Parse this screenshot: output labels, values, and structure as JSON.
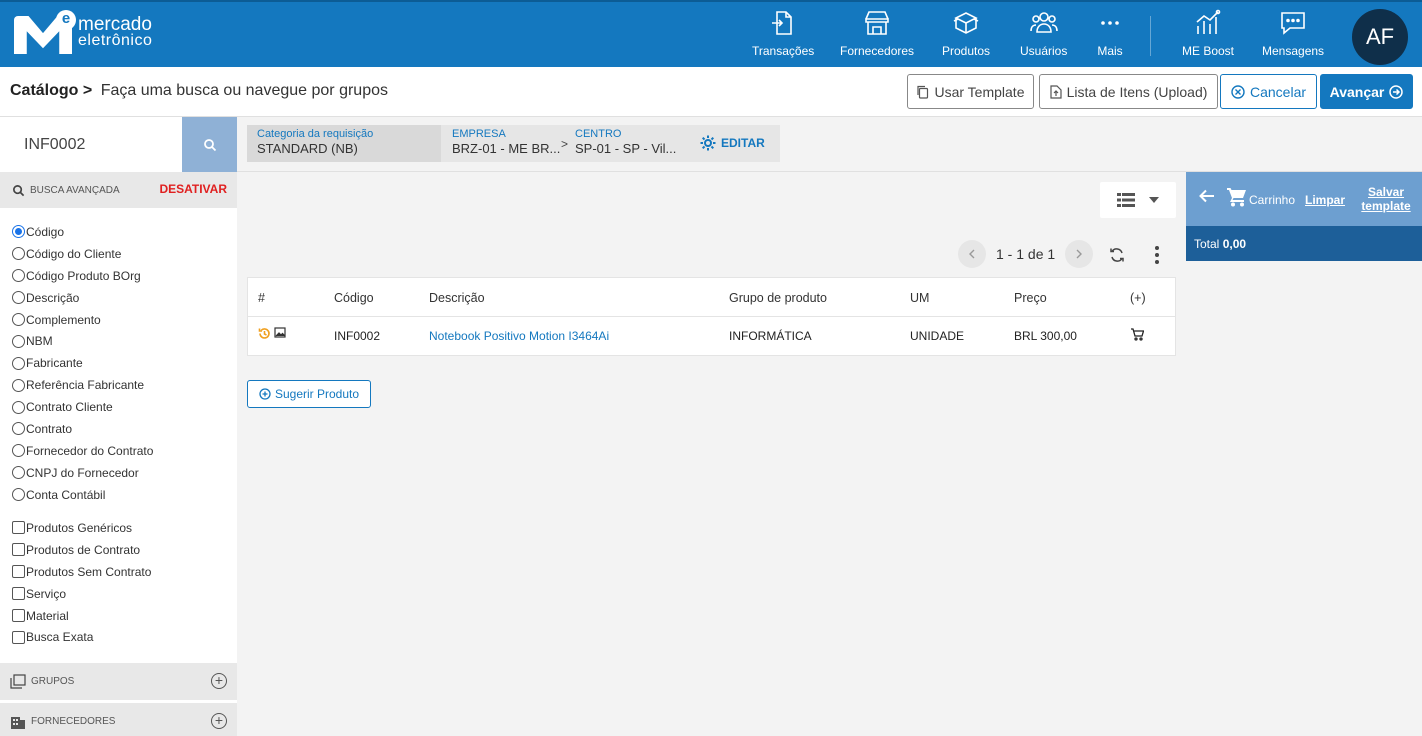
{
  "brand": {
    "line1": "mercado",
    "line2": "eletrônico",
    "mark": "e"
  },
  "nav": [
    {
      "label": "Transações",
      "icon": "transactions-icon"
    },
    {
      "label": "Fornecedores",
      "icon": "store-icon"
    },
    {
      "label": "Produtos",
      "icon": "box-icon"
    },
    {
      "label": "Usuários",
      "icon": "users-icon"
    },
    {
      "label": "Mais",
      "icon": "more-icon"
    },
    {
      "label": "ME Boost",
      "icon": "chart-icon"
    },
    {
      "label": "Mensagens",
      "icon": "messages-icon"
    }
  ],
  "user": {
    "initials": "AF"
  },
  "title": {
    "section": "Catálogo >",
    "text": "Faça uma busca ou navegue por grupos"
  },
  "actions": {
    "template": "Usar Template",
    "upload": "Lista de Itens (Upload)",
    "cancel": "Cancelar",
    "next": "Avançar"
  },
  "search": {
    "value": "INF0002"
  },
  "advanced": {
    "label": "BUSCA AVANÇADA",
    "toggle": "DESATIVAR"
  },
  "radio_options": [
    "Código",
    "Código do Cliente",
    "Código Produto BOrg",
    "Descrição",
    "Complemento",
    "NBM",
    "Fabricante",
    "Referência Fabricante",
    "Contrato Cliente",
    "Contrato",
    "Fornecedor do Contrato",
    "CNPJ do Fornecedor",
    "Conta Contábil"
  ],
  "selected_radio": "Código",
  "checkbox_options": [
    "Produtos Genéricos",
    "Produtos de Contrato",
    "Produtos Sem Contrato",
    "Serviço",
    "Material",
    "Busca Exata"
  ],
  "groups": {
    "groups_label": "GRUPOS",
    "suppliers_label": "FORNECEDORES"
  },
  "filters": {
    "category_label": "Categoria da requisição",
    "category_value": "STANDARD (NB)",
    "company_label": "EMPRESA",
    "company_value": "BRZ-01 - ME BR...",
    "separator": ">",
    "center_label": "CENTRO",
    "center_value": "SP-01 - SP - Vil...",
    "edit": "EDITAR"
  },
  "pager": {
    "text": "1 - 1 de 1"
  },
  "table": {
    "headers": {
      "num": "#",
      "code": "Código",
      "desc": "Descrição",
      "group": "Grupo de produto",
      "um": "UM",
      "price": "Preço",
      "add": "(+)"
    },
    "rows": [
      {
        "code": "INF0002",
        "desc": "Notebook Positivo Motion I3464Ai",
        "group": "INFORMÁTICA",
        "um": "UNIDADE",
        "price": "BRL 300,00"
      }
    ]
  },
  "suggest": "Sugerir Produto",
  "cart": {
    "title": "Carrinho",
    "clear": "Limpar",
    "save": "Salvar template",
    "total_label": "Total",
    "total_value": "0,00"
  }
}
